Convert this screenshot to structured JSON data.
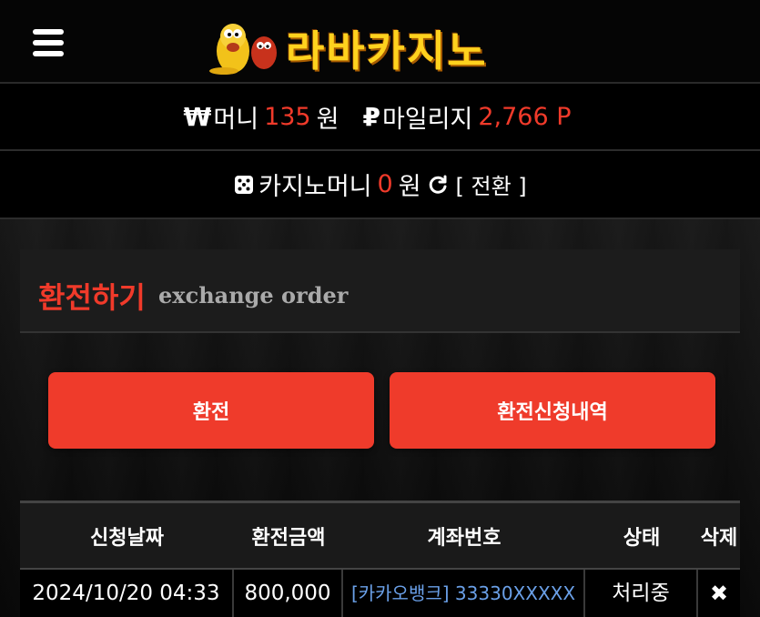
{
  "header": {
    "logo_text": "라바카지노"
  },
  "balance": {
    "money_symbol": "₩",
    "money_label": "머니",
    "money_value": "135",
    "money_unit": "원",
    "mileage_symbol": "₽",
    "mileage_label": "마일리지",
    "mileage_value": "2,766 P"
  },
  "casino": {
    "label": "카지노머니",
    "value": "0",
    "unit": "원",
    "convert_label": "[ 전환 ]"
  },
  "panel": {
    "title": "환전하기",
    "subtitle": "exchange order"
  },
  "actions": {
    "exchange_label": "환전",
    "history_label": "환전신청내역"
  },
  "table": {
    "headers": [
      "신청날짜",
      "환전금액",
      "계좌번호",
      "상태",
      "삭제"
    ],
    "rows": [
      {
        "date": "2024/10/20 04:33",
        "amount": "800,000",
        "account": "[카카오뱅크] 33330XXXXX",
        "status": "처리중",
        "delete": "✖"
      }
    ]
  },
  "colors": {
    "accent_red": "#ef3b2b",
    "logo_yellow": "#ffd21e",
    "account_blue": "#6aa0e8"
  },
  "icons": [
    "menu-icon",
    "dice-icon",
    "refresh-icon",
    "close-icon"
  ]
}
